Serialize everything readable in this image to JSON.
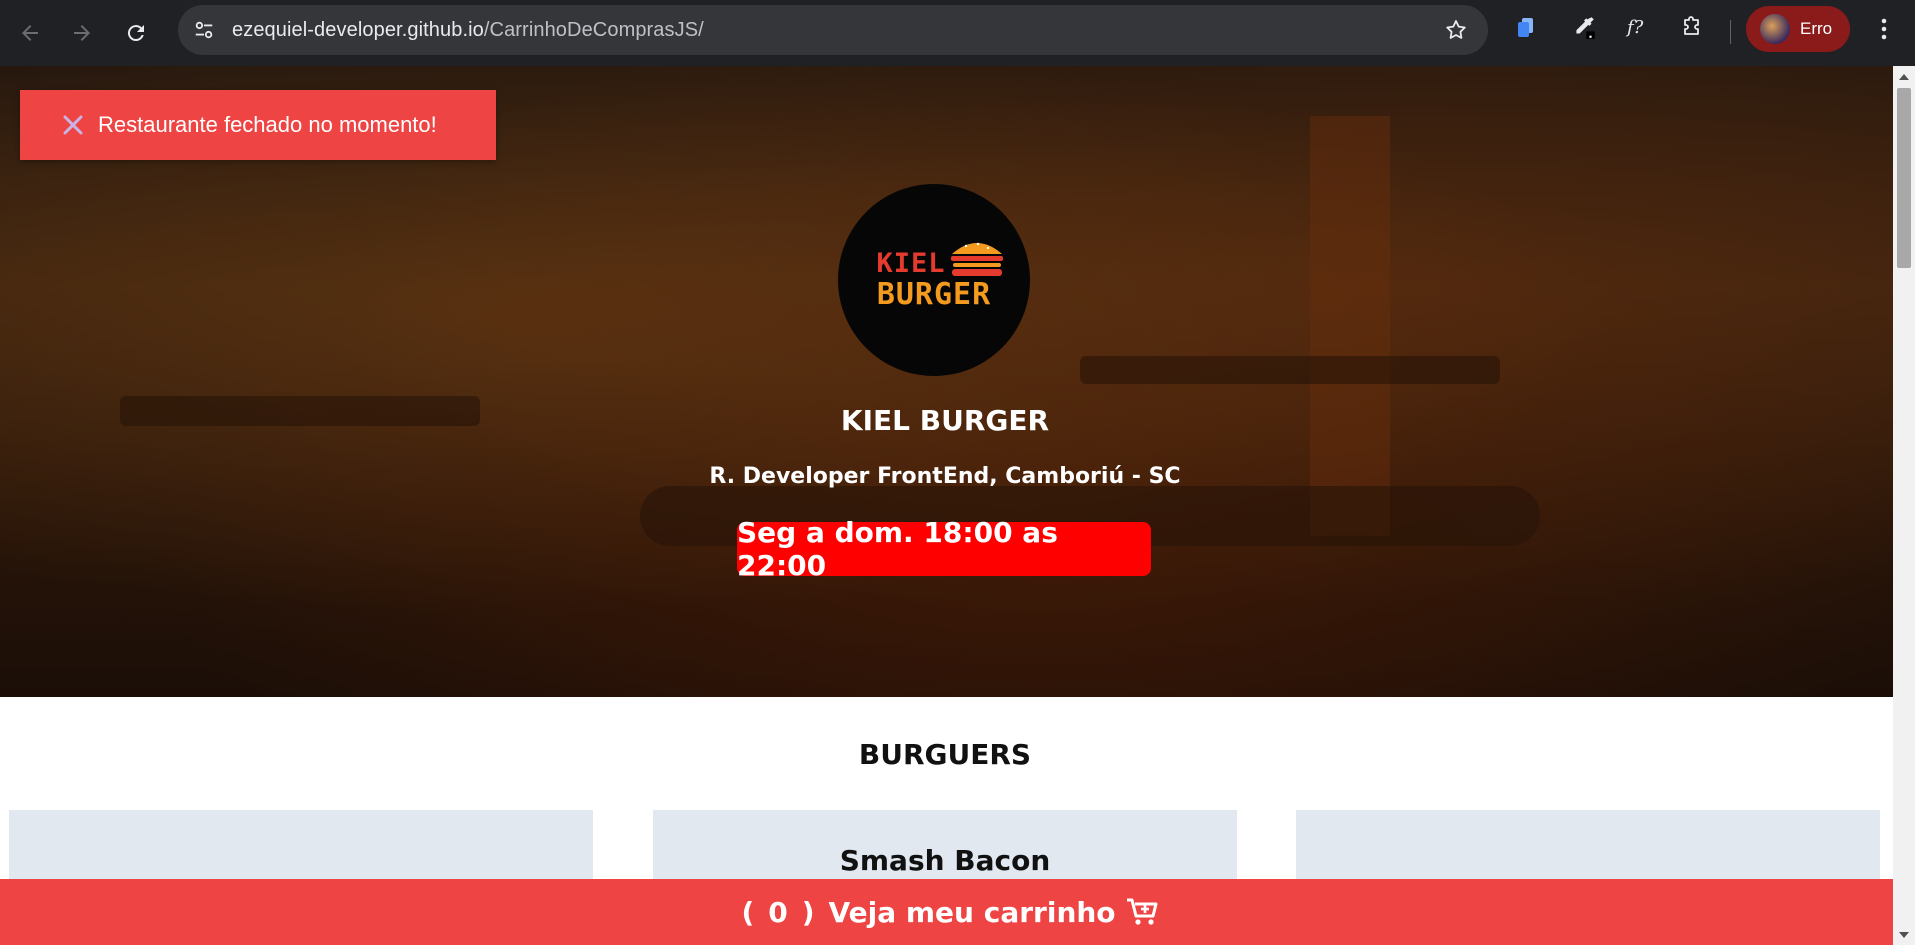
{
  "browser": {
    "url_host": "ezequiel-developer.github.io",
    "url_path": "/CarrinhoDeComprasJS/",
    "profile_label": "Erro",
    "icons": [
      "back-icon",
      "forward-icon",
      "reload-icon",
      "site-info-icon",
      "star-icon",
      "copy-extension-icon",
      "eyedropper-icon",
      "formula-extension-icon",
      "extensions-puzzle-icon",
      "menu-dots-icon"
    ]
  },
  "toast": {
    "message": "Restaurante fechado no momento!",
    "icon": "close-x-icon",
    "color": "#ef4444"
  },
  "hero": {
    "logo_line1": "KIEL",
    "logo_line2": "BURGER",
    "restaurant_name": "KIEL BURGER",
    "address": "R. Developer FrontEnd, Camboriú - SC",
    "hours": "Seg a dom. 18:00 as 22:00",
    "hours_badge_color": "#ff0000"
  },
  "menu": {
    "section_title": "BURGUERS",
    "cards": [
      {
        "title": ""
      },
      {
        "title": "Smash Bacon"
      },
      {
        "title": ""
      }
    ]
  },
  "cart": {
    "open_paren": "(",
    "count": "0",
    "close_paren": ")",
    "label": "Veja meu carrinho",
    "icon": "cart-plus-icon",
    "color": "#ef4444"
  }
}
